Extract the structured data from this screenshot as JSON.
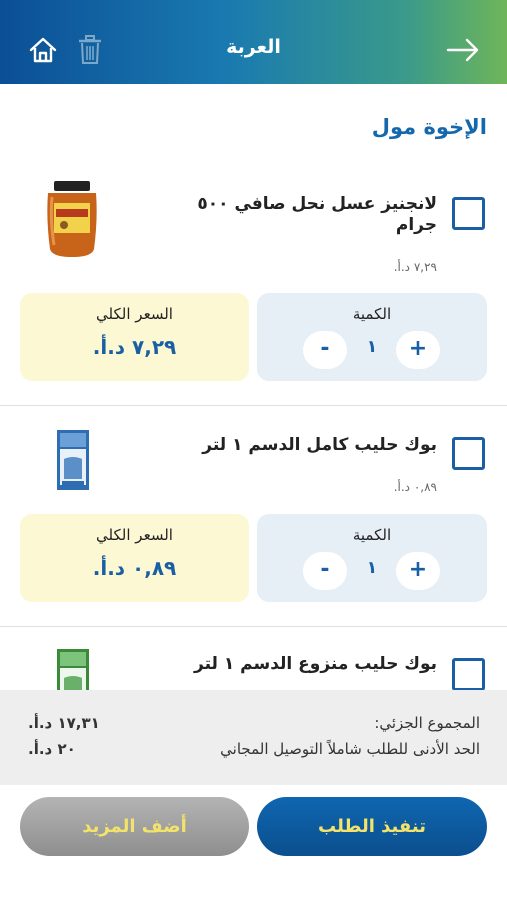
{
  "header": {
    "title": "العربة",
    "icons": [
      "home-icon",
      "trash-icon",
      "arrow-right-icon"
    ]
  },
  "store": {
    "name": "الإخوة مول"
  },
  "items": [
    {
      "name": "لانجنيز عسل نحل صافي ٥٠٠ جرام",
      "unit_price": "٧,٢٩ د.أ.",
      "qty_label": "الكمية",
      "qty": "١",
      "total_label": "السعر الكلي",
      "total": "٧,٢٩ د.أ."
    },
    {
      "name": "بوك حليب كامل الدسم ١ لتر",
      "unit_price": "٠,٨٩ د.أ.",
      "qty_label": "الكمية",
      "qty": "١",
      "total_label": "السعر الكلي",
      "total": "٠,٨٩ د.أ."
    },
    {
      "name": "بوك حليب منزوع الدسم ١ لتر"
    }
  ],
  "summary": {
    "subtotal_label": "المجموع الجزئي:",
    "subtotal_value": "١٧,٣١ د.أ.",
    "min_label": "الحد الأدنى للطلب شاملاً التوصيل المجاني",
    "min_value": "٢٠ د.أ."
  },
  "buttons": {
    "order": "تنفيذ الطلب",
    "add_more": "أضف المزيد"
  },
  "colors": {
    "primary": "#1a5fa3",
    "accent_yellow": "#f4e36a",
    "qty_bg": "#e6eef6",
    "total_bg": "#fdf8d4"
  }
}
